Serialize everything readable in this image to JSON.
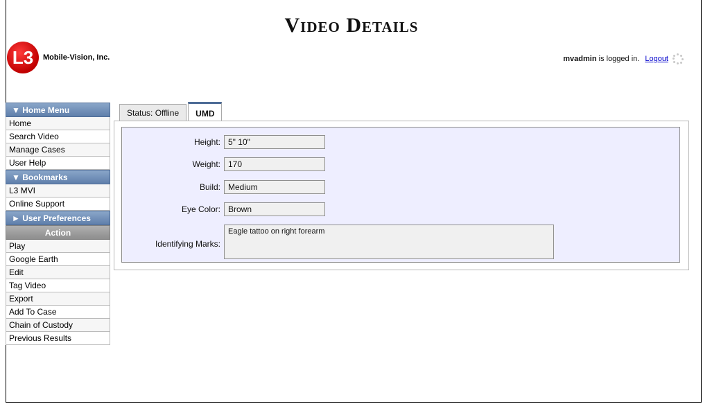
{
  "page_title": "Video Details",
  "logo": {
    "company": "Mobile-Vision, Inc.",
    "mark": "L3"
  },
  "session": {
    "username": "mvadmin",
    "status_text": "is logged in.",
    "logout_label": "Logout"
  },
  "sidebar": {
    "home_menu": {
      "label": "▼  Home Menu",
      "items": [
        "Home",
        "Search Video",
        "Manage Cases",
        "User Help"
      ]
    },
    "bookmarks": {
      "label": "▼  Bookmarks",
      "items": [
        "L3 MVI",
        "Online Support"
      ]
    },
    "user_preferences": {
      "label": "►  User Preferences"
    },
    "action": {
      "label": "Action",
      "items": [
        "Play",
        "Google Earth",
        "Edit",
        "Tag Video",
        "Export",
        "Add To Case",
        "Chain of Custody",
        "Previous Results"
      ]
    }
  },
  "tabs": [
    {
      "label": "Status: Offline",
      "active": false
    },
    {
      "label": "UMD",
      "active": true
    }
  ],
  "umd": {
    "height": {
      "label": "Height:",
      "value": "5\" 10\""
    },
    "weight": {
      "label": "Weight:",
      "value": "170"
    },
    "build": {
      "label": "Build:",
      "value": "Medium"
    },
    "eye_color": {
      "label": "Eye Color:",
      "value": "Brown"
    },
    "identifying_marks": {
      "label": "Identifying Marks:",
      "value": "Eagle tattoo on right forearm"
    }
  },
  "colors": {
    "menu_header": "#5f7fab",
    "panel_bg": "#eeeeff",
    "logo_red": "#d00000",
    "link": "#0000cc"
  }
}
